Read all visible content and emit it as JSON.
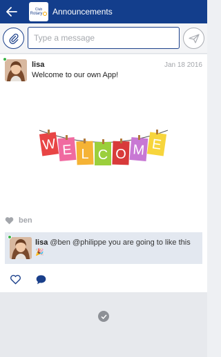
{
  "appbar": {
    "title": "Announcements",
    "logo": {
      "top_text": "Club",
      "bottom_text": "Rotary"
    },
    "back_icon": "back-arrow-icon"
  },
  "composer": {
    "placeholder": "Type a message",
    "attach_icon": "paperclip-icon",
    "send_icon": "send-icon"
  },
  "post": {
    "author": "lisa",
    "date": "Jan 18 2016",
    "text": "Welcome to our own App!",
    "image_letters": [
      "W",
      "E",
      "L",
      "C",
      "O",
      "M",
      "E"
    ],
    "likes": {
      "icon": "heart-icon",
      "names": "ben"
    },
    "comment": {
      "author": "lisa",
      "text": "@ben @philippe you are going to like this",
      "emoji": "🎉"
    },
    "actions": {
      "like_icon": "heart-outline-icon",
      "comment_icon": "comment-bubble-icon"
    }
  },
  "colors": {
    "brand": "#133e8c",
    "online": "#3bb34a",
    "comment_bg": "#e3e8f0"
  }
}
